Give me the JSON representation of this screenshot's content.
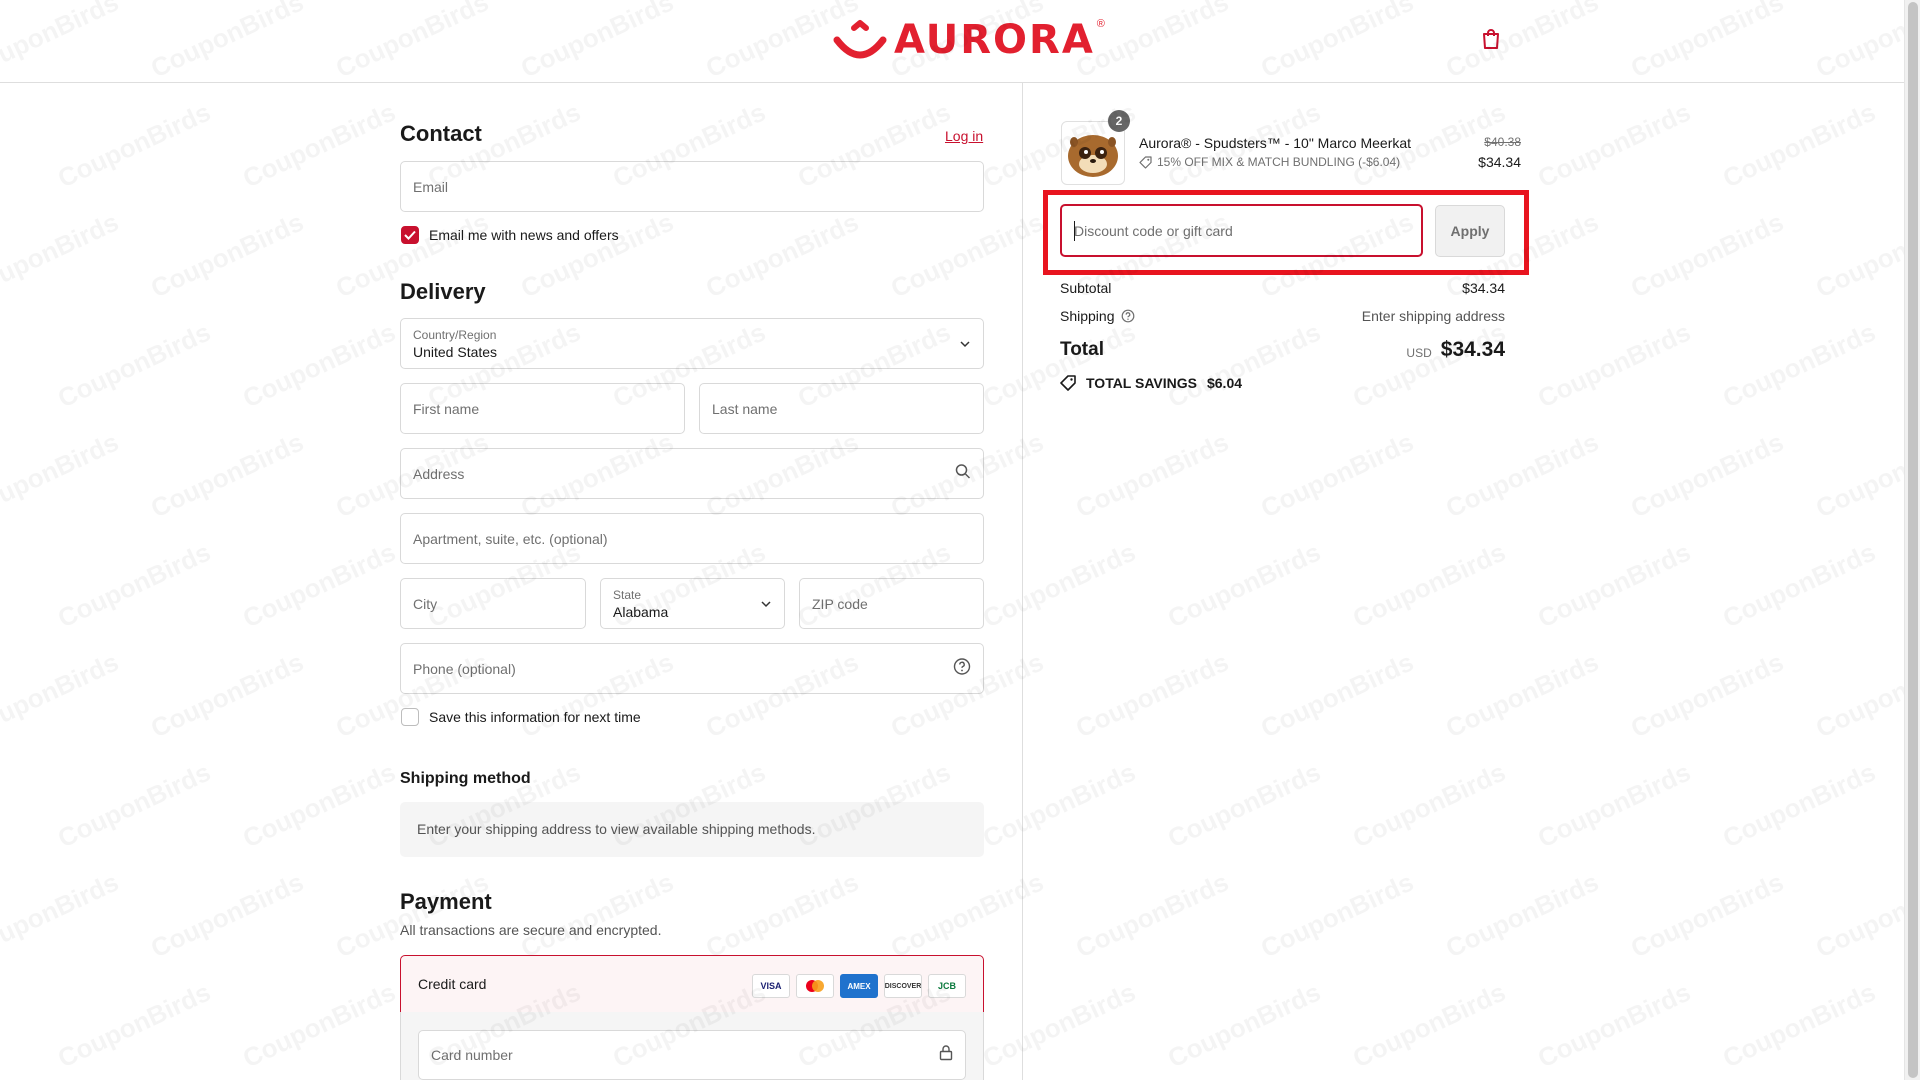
{
  "header": {
    "brand": "AURORA",
    "brand_mark": "®",
    "cart_icon": "shopping-bag-icon"
  },
  "contact": {
    "title": "Contact",
    "login_link": "Log in",
    "email_placeholder": "Email",
    "news_opt_in_label": "Email me with news and offers",
    "news_opt_in_checked": true
  },
  "delivery": {
    "title": "Delivery",
    "country_label": "Country/Region",
    "country_value": "United States",
    "first_name_placeholder": "First name",
    "last_name_placeholder": "Last name",
    "address_placeholder": "Address",
    "apartment_placeholder": "Apartment, suite, etc. (optional)",
    "city_placeholder": "City",
    "state_label": "State",
    "state_value": "Alabama",
    "zip_placeholder": "ZIP code",
    "phone_placeholder": "Phone (optional)",
    "save_info_label": "Save this information for next time",
    "save_info_checked": false
  },
  "shipping_method": {
    "title": "Shipping method",
    "notice": "Enter your shipping address to view available shipping methods."
  },
  "payment": {
    "title": "Payment",
    "subtitle": "All transactions are secure and encrypted.",
    "method_label": "Credit card",
    "card_brands": [
      "VISA",
      "Mastercard",
      "AMEX",
      "DISCOVER",
      "JCB"
    ],
    "card_number_placeholder": "Card number"
  },
  "order": {
    "item": {
      "quantity": "2",
      "name": "Aurora® - Spudsters™ - 10\" Marco Meerkat",
      "discount": "15% OFF MIX & MATCH BUNDLING (-$6.04)",
      "original_price": "$40.38",
      "price": "$34.34"
    },
    "discount_placeholder": "Discount code or gift card",
    "apply_label": "Apply",
    "subtotal_label": "Subtotal",
    "subtotal_value": "$34.34",
    "shipping_label": "Shipping",
    "shipping_value": "Enter shipping address",
    "total_label": "Total",
    "currency": "USD",
    "total_value": "$34.34",
    "savings_label": "TOTAL SAVINGS",
    "savings_value": "$6.04"
  },
  "watermark_text": "CouponBirds",
  "colors": {
    "accent": "#c8102e",
    "brand": "#e2202f",
    "highlight": "#e8141f"
  }
}
